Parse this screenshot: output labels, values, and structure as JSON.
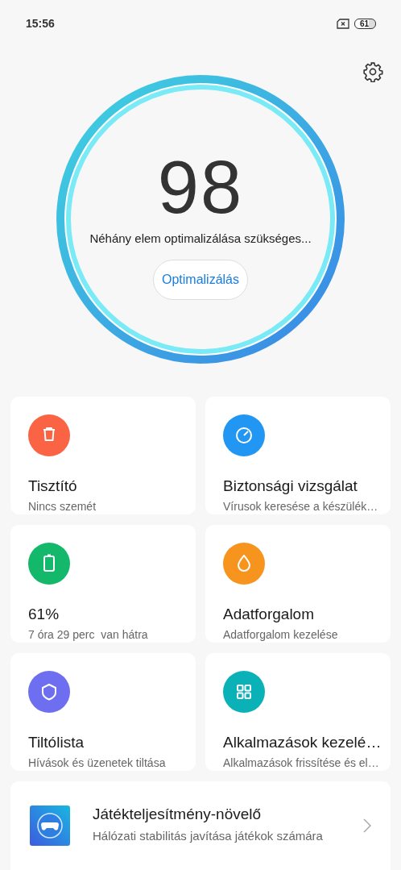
{
  "status_bar": {
    "time": "15:56",
    "battery": "61"
  },
  "score": {
    "value": "98",
    "message": "Néhány elem optimalizálása szükséges...",
    "button": "Optimalizálás"
  },
  "tiles": [
    {
      "kind": "trash",
      "color": "#fa6445",
      "title": "Tisztító",
      "subtitle": "Nincs szemét"
    },
    {
      "kind": "gauge",
      "color": "#2196f3",
      "title": "Biztonsági vizsgálat",
      "subtitle": "Vírusok keresése a készülék…"
    },
    {
      "kind": "battery",
      "color": "#14b86a",
      "title": "61%",
      "subtitle": "7 óra 29 perc  van hátra"
    },
    {
      "kind": "drop",
      "color": "#f7941d",
      "title": "Adatforgalom",
      "subtitle": "Adatforgalom kezelése"
    },
    {
      "kind": "shield",
      "color": "#6e6ff0",
      "title": "Tiltólista",
      "subtitle": "Hívások és üzenetek tiltása"
    },
    {
      "kind": "grid",
      "color": "#0ab2b8",
      "title": "Alkalmazások kezelé…",
      "subtitle": "Alkalmazások frissítése és el…"
    }
  ],
  "feature": {
    "title": "Játékteljesítmény-növelő",
    "subtitle": "Hálózati stabilitás javítása játékok számára"
  }
}
